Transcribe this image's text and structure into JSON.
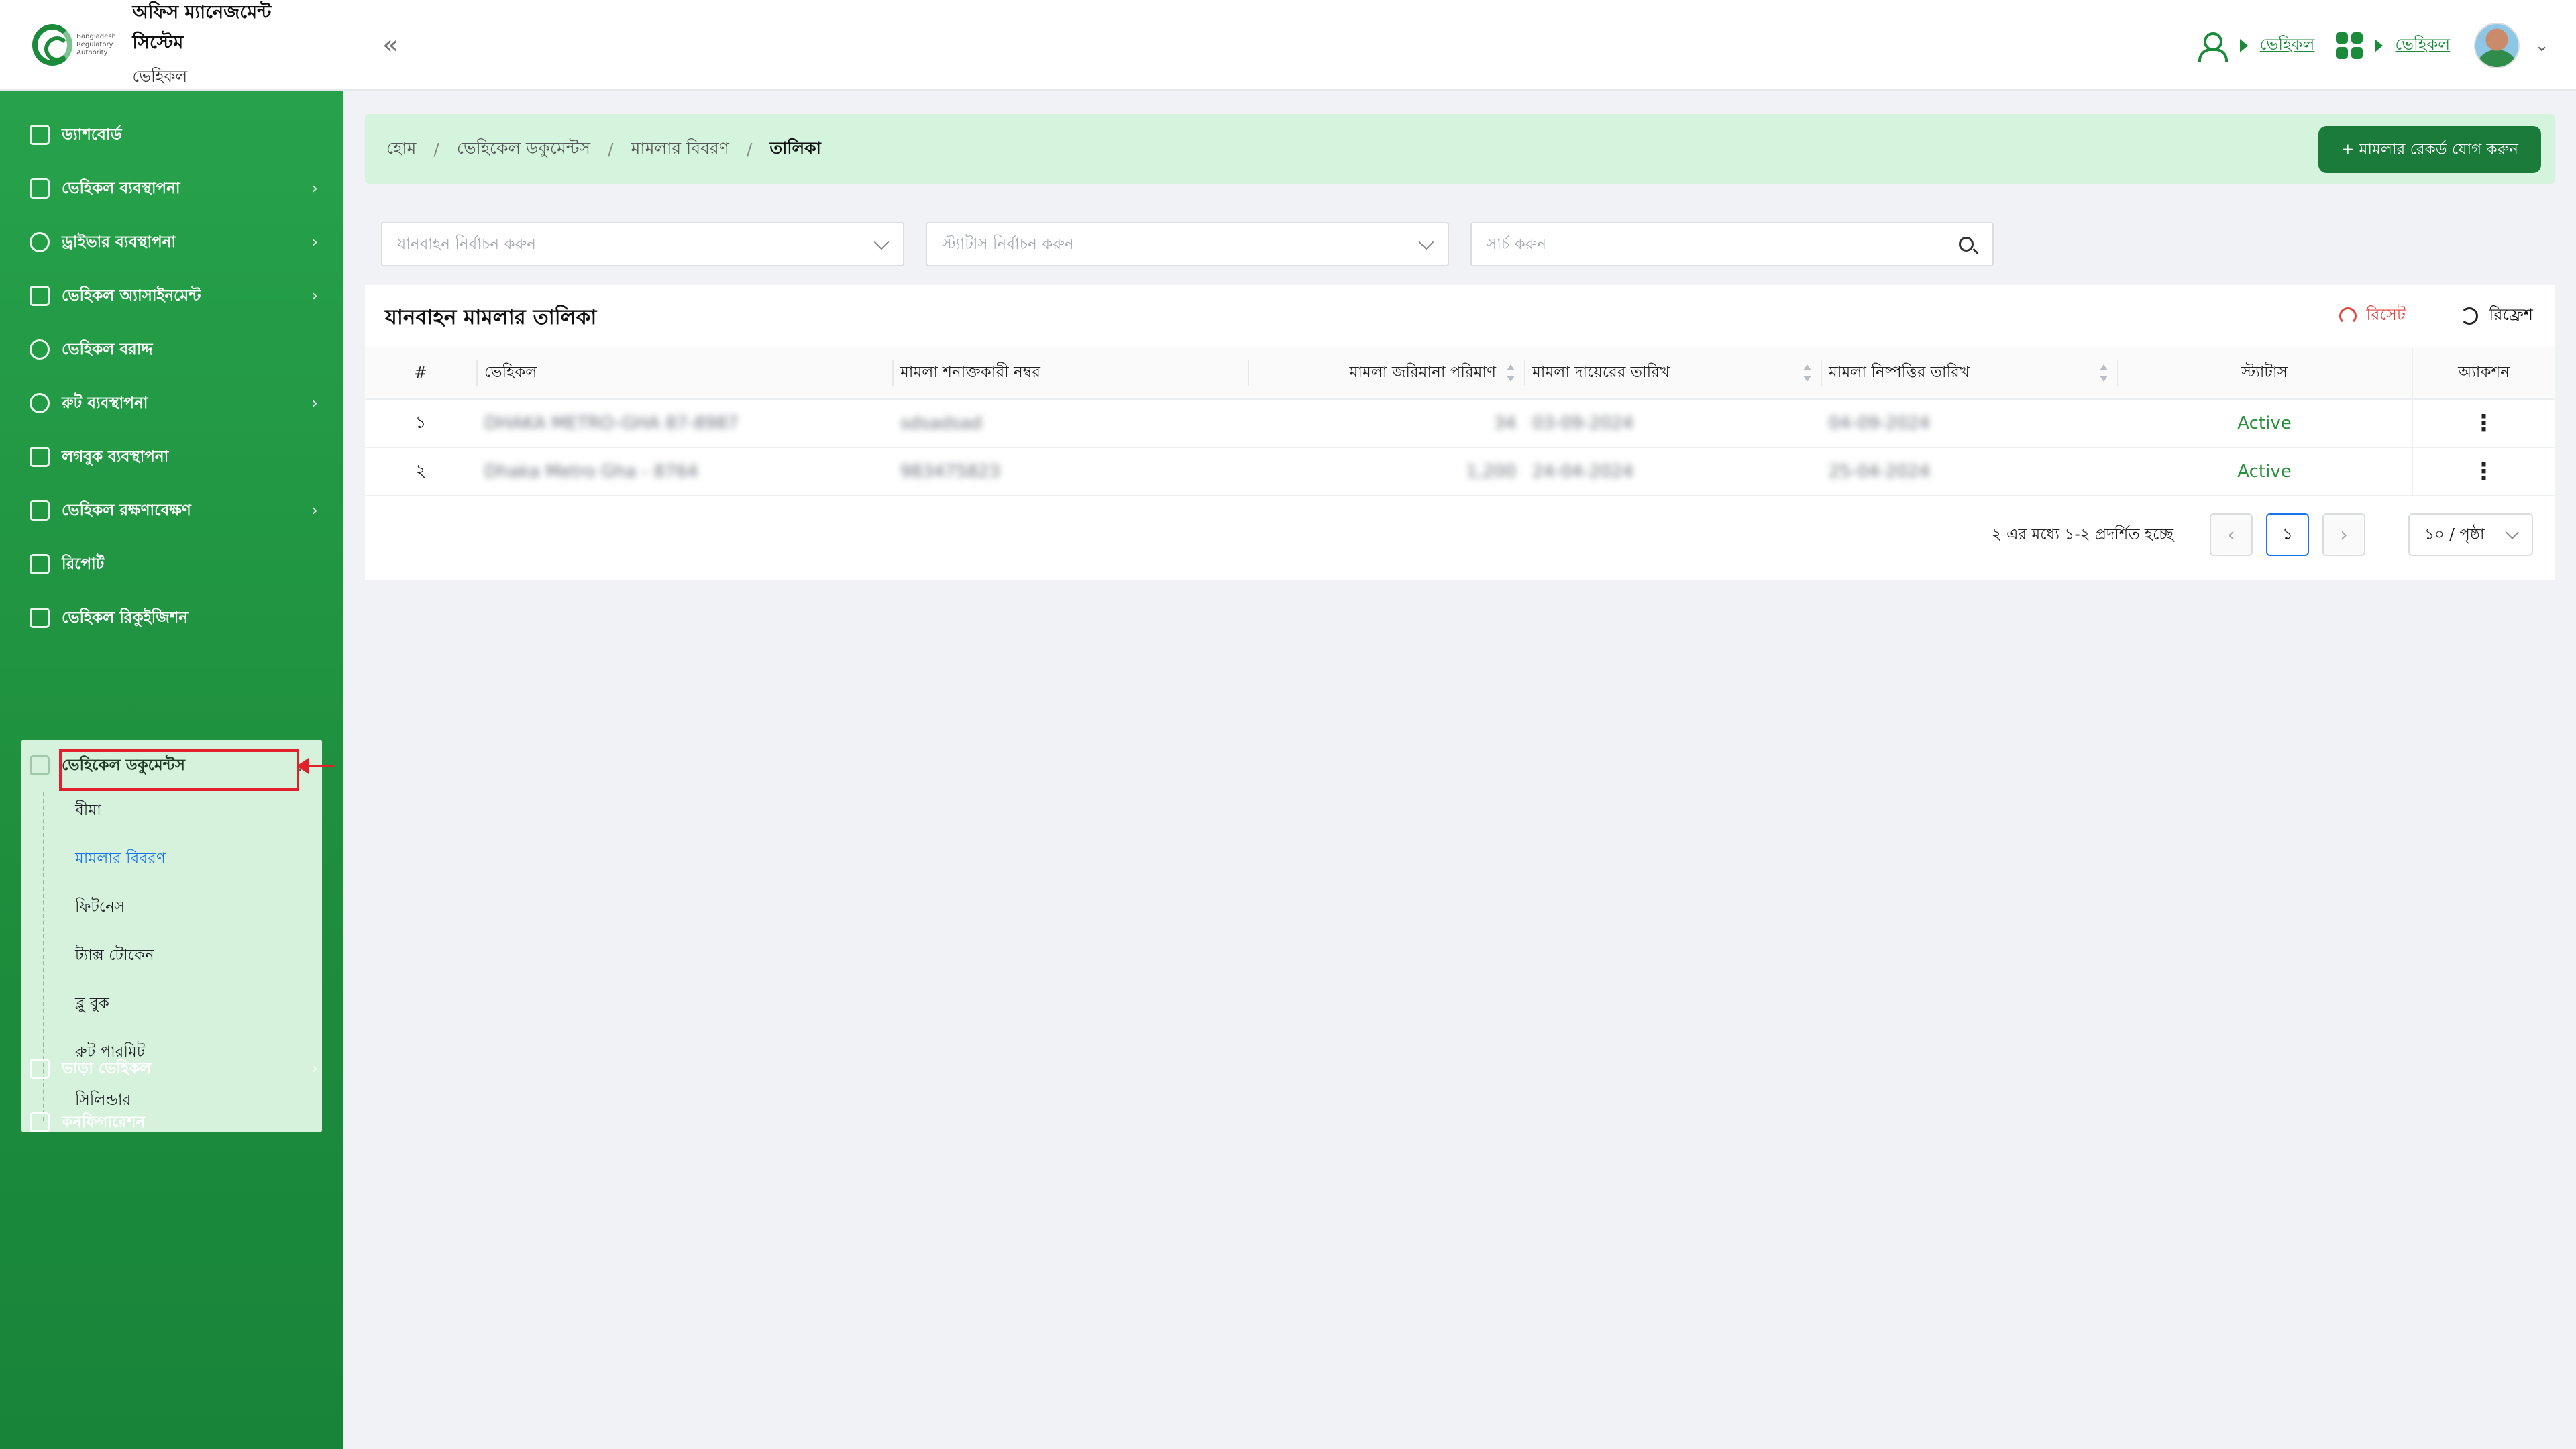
{
  "app": {
    "logo_text": "Bangladesh Regulatory Authority",
    "title": "অফিস ম্যানেজমেন্ট সিস্টেম",
    "subtitle": "ভেহিকল",
    "collapse_icon": "double-chevron-left-icon"
  },
  "header": {
    "link1": "ভেহিকল",
    "link2": "ভেহিকল"
  },
  "sidebar": {
    "items": [
      {
        "label": "ড্যাশবোর্ড",
        "icon": "dashboard-icon"
      },
      {
        "label": "ভেহিকল ব্যবস্থাপনা",
        "icon": "car-icon"
      },
      {
        "label": "ড্রাইভার ব্যবস্থাপনা",
        "icon": "users-icon"
      },
      {
        "label": "ভেহিকল অ্যাসাইনমেন্ট",
        "icon": "assignment-icon"
      },
      {
        "label": "ভেহিকল বরাদ্দ",
        "icon": "allocation-icon"
      },
      {
        "label": "রুট ব্যবস্থাপনা",
        "icon": "route-icon"
      },
      {
        "label": "লগবুক ব্যবস্থাপনা",
        "icon": "logbook-icon"
      },
      {
        "label": "ভেহিকল রক্ষণাবেক্ষণ",
        "icon": "tools-icon"
      },
      {
        "label": "রিপোর্ট",
        "icon": "report-icon"
      },
      {
        "label": "ভেহিকল রিকুইজিশন",
        "icon": "requisition-icon"
      },
      {
        "label": "ভেহিকেল ডকুমেন্টস",
        "icon": "documents-icon"
      },
      {
        "label": "ভাড়া ভেহিকল",
        "icon": "rent-icon"
      },
      {
        "label": "কনফিগারেশন",
        "icon": "config-icon"
      }
    ],
    "submenu": [
      "বীমা",
      "মামলার বিবরণ",
      "ফিটনেস",
      "ট্যাক্স টোকেন",
      "ব্লু বুক",
      "রুট পারমিট",
      "সিলিন্ডার"
    ]
  },
  "breadcrumb": [
    "হোম",
    "ভেহিকেল ডকুমেন্টস",
    "মামলার বিবরণ",
    "তালিকা"
  ],
  "add_button": "+ মামলার রেকর্ড যোগ করুন",
  "filters": {
    "vehicle_placeholder": "যানবাহন নির্বাচন করুন",
    "status_placeholder": "স্ট্যাটাস নির্বাচন করুন",
    "search_placeholder": "সার্চ করুন"
  },
  "table": {
    "title": "যানবাহন মামলার তালিকা",
    "reset": "রিসেট",
    "refresh": "রিফ্রেশ",
    "headers": [
      "#",
      "ভেহিকল",
      "মামলা শনাক্তকারী নম্বর",
      "মামলা জরিমানা পরিমাণ",
      "মামলা দায়েরের তারিখ",
      "মামলা নিষ্পত্তির তারিখ",
      "স্ট্যাটাস",
      "অ্যাকশন"
    ],
    "rows": [
      {
        "no": "১",
        "vehicle": "DHAKA METRO-GHA 87-8987",
        "case_id": "sdsadsad",
        "fine": "34",
        "filed": "03-09-2024",
        "resolved": "04-09-2024",
        "status": "Active"
      },
      {
        "no": "২",
        "vehicle": "Dhaka Metro Gha - 8764",
        "case_id": "983475823",
        "fine": "1,200",
        "filed": "24-04-2024",
        "resolved": "25-04-2024",
        "status": "Active"
      }
    ]
  },
  "pagination": {
    "summary": "২ এর মধ্যে ১-২ প্রদর্শিত হচ্ছে",
    "current_page": "১",
    "page_size": "১০ / পৃষ্ঠা"
  }
}
